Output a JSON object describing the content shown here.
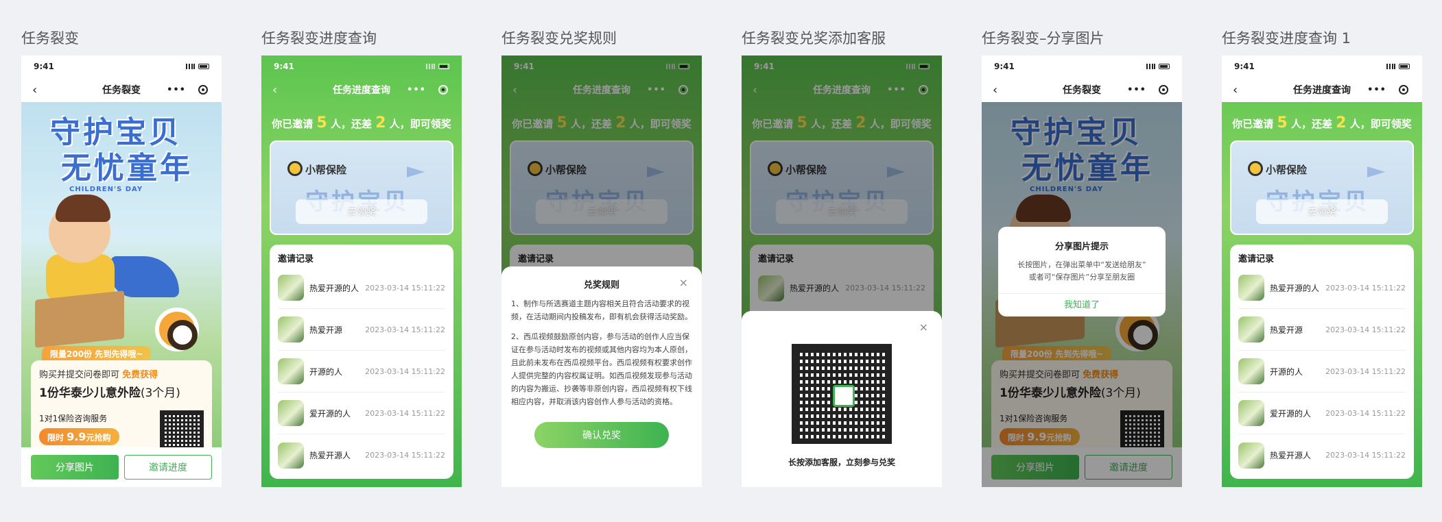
{
  "columns": [
    {
      "title": "任务裂变"
    },
    {
      "title": "任务裂变进度查询"
    },
    {
      "title": "任务裂变兑奖规则"
    },
    {
      "title": "任务裂变兑奖添加客服"
    },
    {
      "title": "任务裂变–分享图片"
    },
    {
      "title": "任务裂变进度查询 1"
    }
  ],
  "status": {
    "time": "9:41"
  },
  "nav": {
    "back_icon": "back-chevron-icon",
    "home_title": "任务裂变",
    "progress_title": "任务进度查询",
    "more_icon": "more-dots-icon",
    "target_icon": "target-icon"
  },
  "hero": {
    "line1": "守护宝贝",
    "line2": "无忧童年",
    "sub": "CHILDREN'S DAY"
  },
  "promo": {
    "tag": "限量200份 先到先得哦~",
    "line1_prefix": "购买并提交问卷即可",
    "line1_highlight": "免费获得",
    "line2": "1份华泰少儿意外险",
    "line2_suffix": "(3个月)",
    "service": "1对1保险咨询服务",
    "limit_prefix": "限时",
    "limit_price": "9.9",
    "limit_suffix": "元抢购"
  },
  "actions": {
    "share": "分享图片",
    "progress": "邀请进度"
  },
  "invite": {
    "prefix": "你已邀请",
    "count": "5",
    "mid": "人，还差",
    "remain": "2",
    "suffix": "人，即可领奖"
  },
  "prize": {
    "logo": "小帮保险",
    "ghost": "守护宝贝",
    "claim": "去领奖"
  },
  "records": {
    "title": "邀请记录",
    "items": [
      {
        "name": "热爱开源的人",
        "date": "2023-03-14 15:11:22"
      },
      {
        "name": "热爱开源",
        "date": "2023-03-14 15:11:22"
      },
      {
        "name": "开源的人",
        "date": "2023-03-14 15:11:22"
      },
      {
        "name": "爱开源的人",
        "date": "2023-03-14 15:11:22"
      },
      {
        "name": "热爱开源人",
        "date": "2023-03-14 15:11:22"
      }
    ]
  },
  "rules": {
    "title": "兑奖规则",
    "close": "×",
    "p1": "1、制作与所选赛道主题内容相关且符合活动要求的视频，在活动期间内投稿发布，即有机会获得活动奖励。",
    "p2": "2、西瓜视频鼓励原创内容，参与活动的创作人应当保证在参与活动时发布的视频或其他内容均为本人原创，且此前未发布在西瓜视频平台。西瓜视频有权要求创作人提供完整的内容权属证明。如西瓜视频发现参与活动的内容为搬运、抄袭等非原创内容，西瓜视频有权下线相应内容，并取消该内容创作人参与活动的资格。",
    "confirm": "确认兑奖"
  },
  "service": {
    "close": "×",
    "caption": "长按添加客服，立刻参与兑奖"
  },
  "share_dialog": {
    "title": "分享图片提示",
    "body1": "长按图片，在弹出菜单中“发送给朋友”",
    "body2": "或者可“保存图片”分享至朋友圈",
    "ok": "我知道了"
  }
}
